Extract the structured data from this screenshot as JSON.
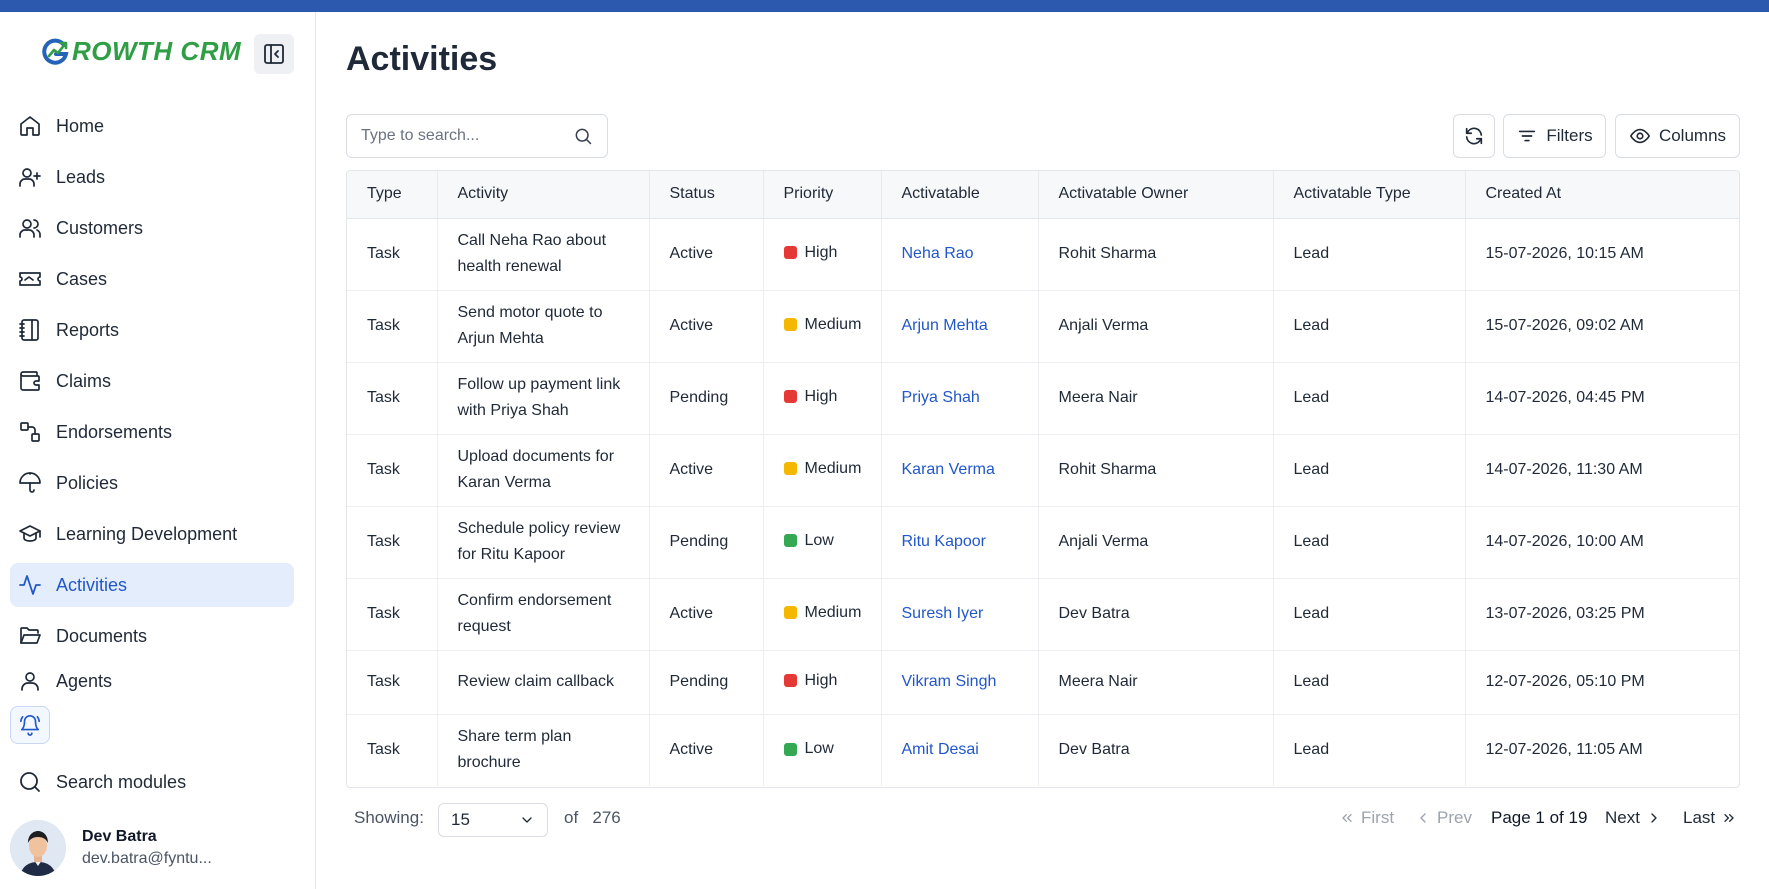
{
  "brand": {
    "logo_text_a": "ROWTH",
    "logo_text_b": " CRM"
  },
  "sidebar": {
    "items": [
      {
        "label": "Home",
        "icon": "home-icon"
      },
      {
        "label": "Leads",
        "icon": "user-plus-icon"
      },
      {
        "label": "Customers",
        "icon": "users-icon"
      },
      {
        "label": "Cases",
        "icon": "ticket-icon"
      },
      {
        "label": "Reports",
        "icon": "notebook-icon"
      },
      {
        "label": "Claims",
        "icon": "wallet-icon"
      },
      {
        "label": "Endorsements",
        "icon": "shapes-icon"
      },
      {
        "label": "Policies",
        "icon": "umbrella-icon"
      },
      {
        "label": "Learning Development",
        "icon": "graduation-cap-icon"
      },
      {
        "label": "Activities",
        "icon": "activity-icon",
        "active": true
      },
      {
        "label": "Documents",
        "icon": "folder-open-icon"
      },
      {
        "label": "Agents",
        "icon": "user-icon"
      }
    ],
    "search_modules": "Search modules",
    "user": {
      "name": "Dev Batra",
      "email": "dev.batra@fyntu..."
    }
  },
  "main": {
    "title": "Activities",
    "search_placeholder": "Type to search...",
    "toolbar": {
      "filters_label": "Filters",
      "columns_label": "Columns"
    },
    "table": {
      "columns": [
        "Type",
        "Activity",
        "Status",
        "Priority",
        "Activatable",
        "Activatable Owner",
        "Activatable Type",
        "Created At"
      ],
      "rows": [
        {
          "type": "Task",
          "activity": [
            "Call Neha Rao about",
            "health renewal"
          ],
          "status": "Active",
          "priority": "High",
          "activatable": "Neha Rao",
          "owner": "Rohit Sharma",
          "atype": "Lead",
          "created": "15-07-2026, 10:15 AM"
        },
        {
          "type": "Task",
          "activity": [
            "Send motor quote to",
            "Arjun Mehta"
          ],
          "status": "Active",
          "priority": "Medium",
          "activatable": "Arjun Mehta",
          "owner": "Anjali Verma",
          "atype": "Lead",
          "created": "15-07-2026, 09:02 AM"
        },
        {
          "type": "Task",
          "activity": [
            "Follow up payment link",
            "with Priya Shah"
          ],
          "status": "Pending",
          "priority": "High",
          "activatable": "Priya Shah",
          "owner": "Meera Nair",
          "atype": "Lead",
          "created": "14-07-2026, 04:45 PM"
        },
        {
          "type": "Task",
          "activity": [
            "Upload documents for",
            "Karan Verma"
          ],
          "status": "Active",
          "priority": "Medium",
          "activatable": "Karan Verma",
          "owner": "Rohit Sharma",
          "atype": "Lead",
          "created": "14-07-2026, 11:30 AM"
        },
        {
          "type": "Task",
          "activity": [
            "Schedule policy review",
            "for Ritu Kapoor"
          ],
          "status": "Pending",
          "priority": "Low",
          "activatable": "Ritu Kapoor",
          "owner": "Anjali Verma",
          "atype": "Lead",
          "created": "14-07-2026, 10:00 AM"
        },
        {
          "type": "Task",
          "activity": [
            "Confirm endorsement",
            "request"
          ],
          "status": "Active",
          "priority": "Medium",
          "activatable": "Suresh Iyer",
          "owner": "Dev Batra",
          "atype": "Lead",
          "created": "13-07-2026, 03:25 PM"
        },
        {
          "type": "Task",
          "activity": [
            "Review claim callback",
            ""
          ],
          "status": "Pending",
          "priority": "High",
          "activatable": "Vikram Singh",
          "owner": "Meera Nair",
          "atype": "Lead",
          "created": "12-07-2026, 05:10 PM"
        },
        {
          "type": "Task",
          "activity": [
            "Share term plan",
            "brochure"
          ],
          "status": "Active",
          "priority": "Low",
          "activatable": "Amit Desai",
          "owner": "Dev Batra",
          "atype": "Lead",
          "created": "12-07-2026, 11:05 AM"
        }
      ]
    },
    "priority_colors": {
      "High": "#e53935",
      "Medium": "#f5b800",
      "Low": "#34a853"
    },
    "footer": {
      "showing_label": "Showing:",
      "page_size": "15",
      "of_label": "of",
      "total": "276",
      "first_label": "First",
      "prev_label": "Prev",
      "page_info": "Page 1 of 19",
      "next_label": "Next",
      "last_label": "Last"
    }
  }
}
